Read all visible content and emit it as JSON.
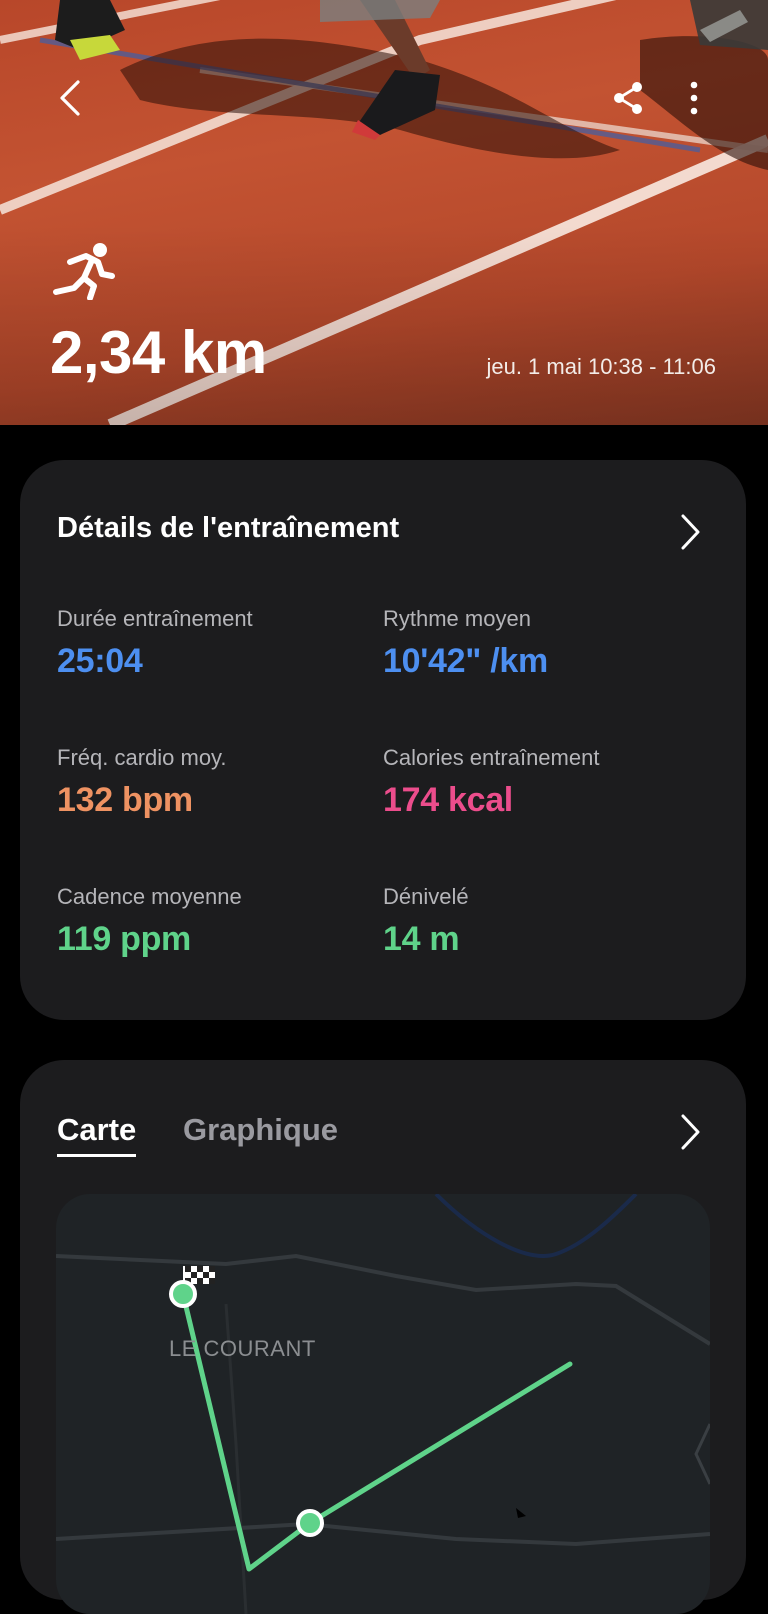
{
  "header": {
    "distance": "2,34 km",
    "datetime": "jeu. 1 mai 10:38 - 11:06",
    "icons": {
      "back": "back-arrow-icon",
      "share": "share-icon",
      "more": "more-vertical-icon",
      "activity": "running-icon"
    }
  },
  "details": {
    "title": "Détails de l'entraînement",
    "stats": [
      {
        "label": "Durée entraînement",
        "value": "25:04",
        "color": "#4d8ff0"
      },
      {
        "label": "Rythme moyen",
        "value": "10'42\" /km",
        "color": "#4d8ff0"
      },
      {
        "label": "Fréq. cardio moy.",
        "value": "132 bpm",
        "color": "#ee9262"
      },
      {
        "label": "Calories entraînement",
        "value": "174 kcal",
        "color": "#ec4d8c"
      },
      {
        "label": "Cadence moyenne",
        "value": "119 ppm",
        "color": "#5fd38a"
      },
      {
        "label": "Dénivelé",
        "value": "14 m",
        "color": "#5fd38a"
      }
    ]
  },
  "map_section": {
    "tabs": [
      "Carte",
      "Graphique"
    ],
    "active_tab": "Carte",
    "place_label": "LE COURANT",
    "route_color": "#5fd38a"
  }
}
